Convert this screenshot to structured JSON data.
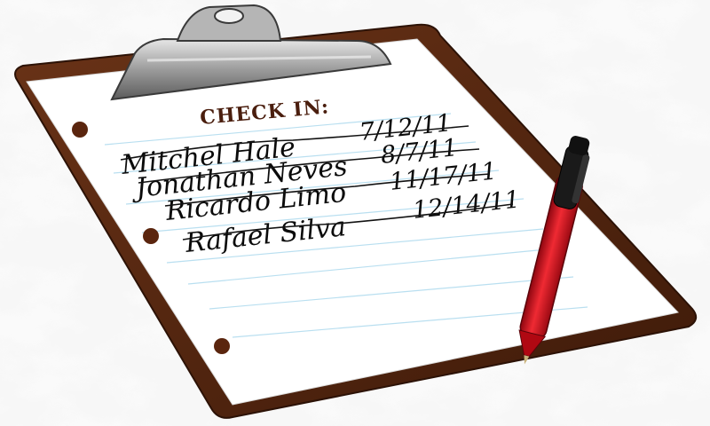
{
  "clipboard": {
    "heading": "CHECK IN:",
    "entries": [
      {
        "name": "Mitchel Hale",
        "date": "7/12/11"
      },
      {
        "name": "Jonathan Neves",
        "date": "8/7/11"
      },
      {
        "name": "Ricardo Limo",
        "date": "11/17/11"
      },
      {
        "name": "Rafael Silva",
        "date": "12/14/11"
      }
    ]
  },
  "colors": {
    "board": "#5a2a12",
    "board_edge": "#3b1a0a",
    "paper": "#ffffff",
    "rule_line": "#b9dff0",
    "ink": "#0b0b0b",
    "heading": "#4a1e0e",
    "pen_body": "#d0101e",
    "pen_cap": "#1a1a1a",
    "clip_metal": "#a9a9a9",
    "marble": "#e9e9e9"
  },
  "icons": {
    "clip": "binder-clip-icon",
    "pen": "pen-icon",
    "holes": "punch-hole-icon"
  }
}
